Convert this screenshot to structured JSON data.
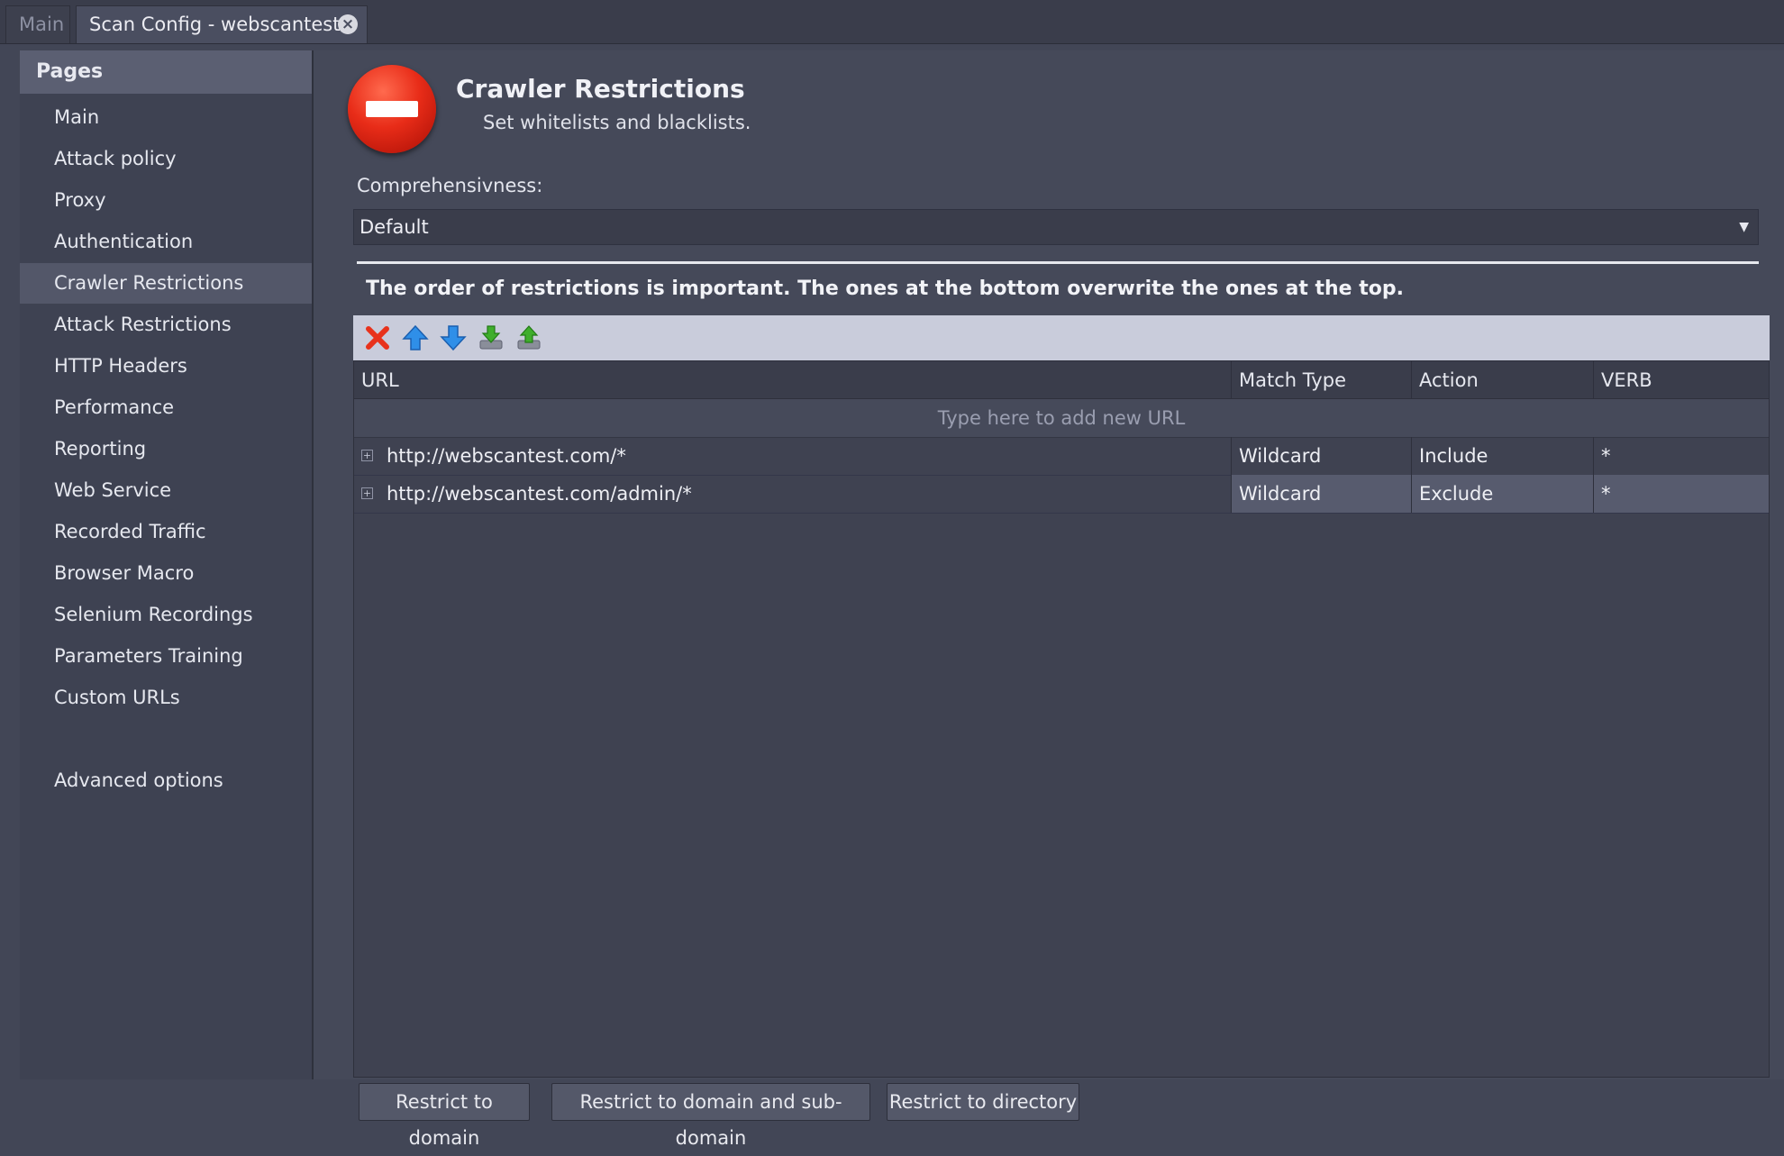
{
  "tabs": [
    {
      "label": "Main"
    },
    {
      "label": "Scan Config - webscantest"
    }
  ],
  "sidebar": {
    "header": "Pages",
    "items": [
      {
        "label": "Main"
      },
      {
        "label": "Attack policy"
      },
      {
        "label": "Proxy"
      },
      {
        "label": "Authentication"
      },
      {
        "label": "Crawler Restrictions",
        "selected": true
      },
      {
        "label": "Attack Restrictions"
      },
      {
        "label": "HTTP Headers"
      },
      {
        "label": "Performance"
      },
      {
        "label": "Reporting"
      },
      {
        "label": "Web Service"
      },
      {
        "label": "Recorded Traffic"
      },
      {
        "label": "Browser Macro"
      },
      {
        "label": "Selenium Recordings"
      },
      {
        "label": "Parameters Training"
      },
      {
        "label": "Custom URLs"
      },
      {
        "label": "Advanced options"
      }
    ]
  },
  "page": {
    "title": "Crawler Restrictions",
    "subtitle": "Set whitelists and blacklists.",
    "icon": "stop-sign-icon",
    "comprehensiveness_label": "Comprehensivness:",
    "comprehensiveness_value": "Default",
    "notice": "The order of restrictions is important. The ones at the bottom overwrite the ones at the top."
  },
  "toolbar": {
    "icons": [
      "delete-icon",
      "move-up-icon",
      "move-down-icon",
      "import-icon",
      "export-icon"
    ]
  },
  "grid": {
    "columns": [
      "URL",
      "Match Type",
      "Action",
      "VERB"
    ],
    "add_placeholder": "Type here to add new URL",
    "rows": [
      {
        "url": "http://webscantest.com/*",
        "match_type": "Wildcard",
        "action": "Include",
        "verb": "*"
      },
      {
        "url": "http://webscantest.com/admin/*",
        "match_type": "Wildcard",
        "action": "Exclude",
        "verb": "*"
      }
    ]
  },
  "buttons": {
    "restrict_domain": "Restrict to domain",
    "restrict_subdomain": "Restrict to domain and sub-domain",
    "restrict_directory": "Restrict to directory"
  },
  "colors": {
    "background": "#424656",
    "sidebar": "#3e4252",
    "selected": "#535769",
    "toolbar": "#c9ccdb",
    "accent_red": "#e82c18"
  }
}
